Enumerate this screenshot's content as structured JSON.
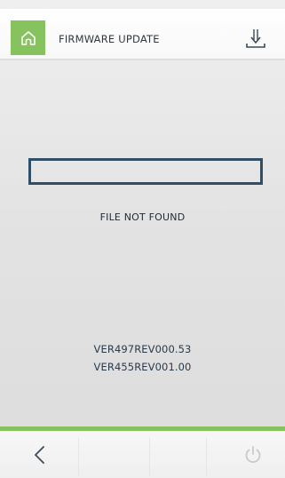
{
  "header": {
    "title": "FIRMWARE UPDATE",
    "home_icon": "home-icon",
    "download_icon": "download-icon"
  },
  "status": {
    "message": "FILE NOT FOUND"
  },
  "versions": [
    "VER497REV000.53",
    "VER455REV001.00"
  ],
  "footer": {
    "back_icon": "chevron-left-icon",
    "power_icon": "power-icon"
  },
  "colors": {
    "accent": "#86c25d",
    "progress_border": "#2f4f68",
    "text": "#303842"
  }
}
